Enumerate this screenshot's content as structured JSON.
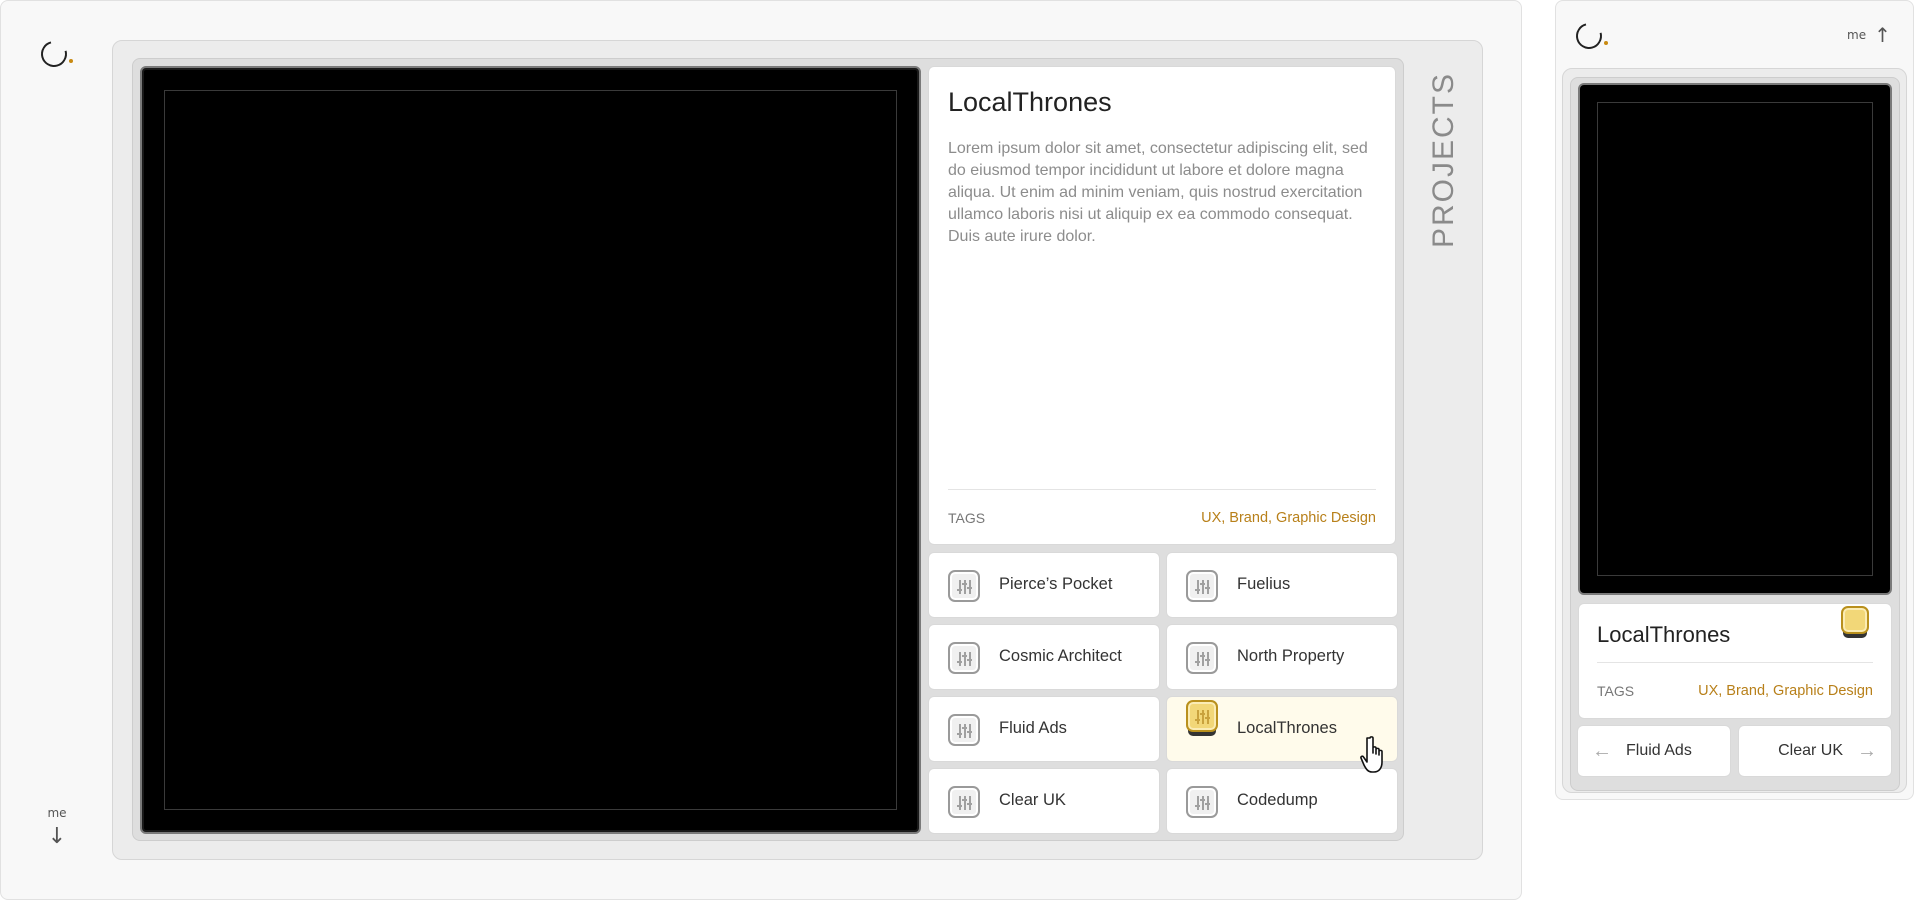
{
  "desktop": {
    "section_label": "PROJECTS",
    "me_label": "me",
    "me_arrow": "↓",
    "project": {
      "title": "LocalThrones",
      "description": "Lorem ipsum dolor sit amet, consectetur adipiscing elit, sed do eiusmod tempor incididunt ut labore et dolore magna aliqua. Ut enim ad minim veniam, quis nostrud exercitation ullamco laboris nisi ut aliquip ex ea commodo consequat. Duis aute irure dolor.",
      "tags_label": "TAGS",
      "tags": "UX, Brand, Graphic Design"
    },
    "projects": [
      {
        "label": "Pierce’s Pocket"
      },
      {
        "label": "Fuelius"
      },
      {
        "label": "Cosmic Architect"
      },
      {
        "label": "North Property"
      },
      {
        "label": "Fluid Ads"
      },
      {
        "label": "LocalThrones",
        "active": true
      },
      {
        "label": "Clear UK"
      },
      {
        "label": "Codedump"
      }
    ]
  },
  "mobile": {
    "me_label": "me",
    "me_arrow": "↑",
    "project_title": "LocalThrones",
    "tags_label": "TAGS",
    "tags": "UX, Brand, Graphic Design",
    "prev_label": "Fluid Ads",
    "prev_arrow": "←",
    "next_label": "Clear UK",
    "next_arrow": "→"
  },
  "colors": {
    "accent": "#b8801a",
    "active_icon": "#f2d778",
    "active_bg": "#fffbeb"
  }
}
